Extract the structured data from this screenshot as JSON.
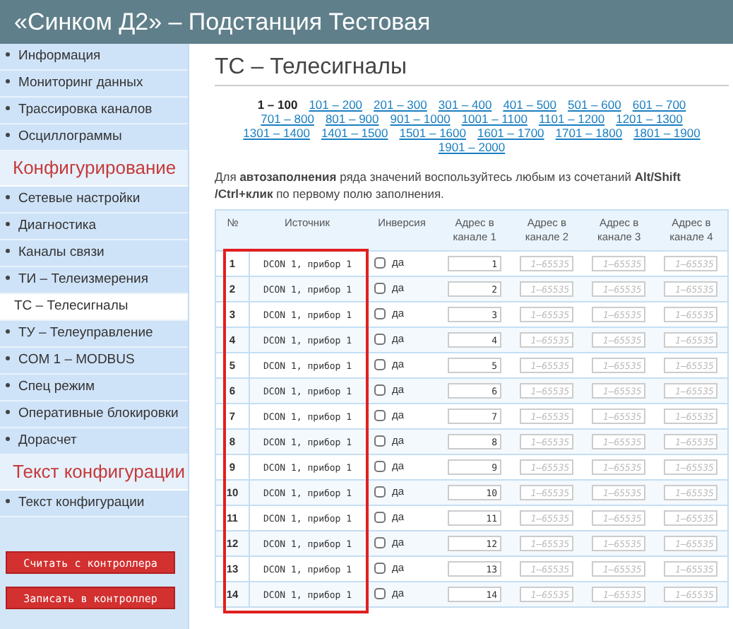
{
  "header": {
    "title": "«Синком Д2» – Подстанция Тестовая"
  },
  "sidebar": {
    "items": [
      {
        "kind": "item",
        "label": "Информация",
        "selected": false
      },
      {
        "kind": "item",
        "label": "Мониторинг данных",
        "selected": false
      },
      {
        "kind": "item",
        "label": "Трассировка каналов",
        "selected": false
      },
      {
        "kind": "item",
        "label": "Осциллограммы",
        "selected": false
      },
      {
        "kind": "section",
        "label": "Конфигурирование"
      },
      {
        "kind": "item",
        "label": "Сетевые настройки",
        "selected": false
      },
      {
        "kind": "item",
        "label": "Диагностика",
        "selected": false
      },
      {
        "kind": "item",
        "label": "Каналы связи",
        "selected": false
      },
      {
        "kind": "item",
        "label": "ТИ – Телеизмерения",
        "selected": false
      },
      {
        "kind": "item",
        "label": "ТС – Телесигналы",
        "selected": true
      },
      {
        "kind": "item",
        "label": "ТУ – Телеуправление",
        "selected": false
      },
      {
        "kind": "item",
        "label": "COM 1 – MODBUS",
        "selected": false
      },
      {
        "kind": "item",
        "label": "Спец режим",
        "selected": false
      },
      {
        "kind": "item",
        "label": "Оперативные блокировки",
        "selected": false
      },
      {
        "kind": "item",
        "label": "Дорасчет",
        "selected": false
      },
      {
        "kind": "section",
        "label": "Текст конфигурации"
      },
      {
        "kind": "item",
        "label": "Текст конфигурации",
        "selected": false
      }
    ],
    "buttons": [
      "Считать с контроллера",
      "Записать в контроллер"
    ]
  },
  "page": {
    "title": "ТС – Телесигналы",
    "ranges": [
      {
        "label": "1 – 100",
        "selected": true
      },
      {
        "label": "101 – 200",
        "selected": false
      },
      {
        "label": "201 – 300",
        "selected": false
      },
      {
        "label": "301 – 400",
        "selected": false
      },
      {
        "label": "401 – 500",
        "selected": false
      },
      {
        "label": "501 – 600",
        "selected": false
      },
      {
        "label": "601 – 700",
        "selected": false
      },
      {
        "label": "701 – 800",
        "selected": false
      },
      {
        "label": "801 – 900",
        "selected": false
      },
      {
        "label": "901 – 1000",
        "selected": false
      },
      {
        "label": "1001 – 1100",
        "selected": false
      },
      {
        "label": "1101 – 1200",
        "selected": false
      },
      {
        "label": "1201 – 1300",
        "selected": false
      },
      {
        "label": "1301 – 1400",
        "selected": false
      },
      {
        "label": "1401 – 1500",
        "selected": false
      },
      {
        "label": "1501 – 1600",
        "selected": false
      },
      {
        "label": "1601 – 1700",
        "selected": false
      },
      {
        "label": "1701 – 1800",
        "selected": false
      },
      {
        "label": "1801 – 1900",
        "selected": false
      },
      {
        "label": "1901 – 2000",
        "selected": false
      }
    ],
    "hint": "Для **автозаполнения** ряда значений воспользуйтесь любым из сочетаний **Alt/Shift /Ctrl+клик** по первому полю заполнения.",
    "table": {
      "columns": [
        "№",
        "Источник",
        "Инверсия",
        "Адрес в канале 1",
        "Адрес в канале 2",
        "Адрес в канале 3",
        "Адрес в канале 4"
      ],
      "rows": [
        {
          "number": "1",
          "source": "DCON 1, прибор 1",
          "inversion": {
            "label": "да",
            "checked": false
          },
          "addresses": [
            {
              "value": "1"
            },
            {
              "placeholder": "1–65535"
            },
            {
              "placeholder": "1–65535"
            },
            {
              "placeholder": "1–65535"
            }
          ]
        },
        {
          "number": "2",
          "source": "DCON 1, прибор 1",
          "inversion": {
            "label": "да",
            "checked": false
          },
          "addresses": [
            {
              "value": "2"
            },
            {
              "placeholder": "1–65535"
            },
            {
              "placeholder": "1–65535"
            },
            {
              "placeholder": "1–65535"
            }
          ]
        },
        {
          "number": "3",
          "source": "DCON 1, прибор 1",
          "inversion": {
            "label": "да",
            "checked": false
          },
          "addresses": [
            {
              "value": "3"
            },
            {
              "placeholder": "1–65535"
            },
            {
              "placeholder": "1–65535"
            },
            {
              "placeholder": "1–65535"
            }
          ]
        },
        {
          "number": "4",
          "source": "DCON 1, прибор 1",
          "inversion": {
            "label": "да",
            "checked": false
          },
          "addresses": [
            {
              "value": "4"
            },
            {
              "placeholder": "1–65535"
            },
            {
              "placeholder": "1–65535"
            },
            {
              "placeholder": "1–65535"
            }
          ]
        },
        {
          "number": "5",
          "source": "DCON 1, прибор 1",
          "inversion": {
            "label": "да",
            "checked": false
          },
          "addresses": [
            {
              "value": "5"
            },
            {
              "placeholder": "1–65535"
            },
            {
              "placeholder": "1–65535"
            },
            {
              "placeholder": "1–65535"
            }
          ]
        },
        {
          "number": "6",
          "source": "DCON 1, прибор 1",
          "inversion": {
            "label": "да",
            "checked": false
          },
          "addresses": [
            {
              "value": "6"
            },
            {
              "placeholder": "1–65535"
            },
            {
              "placeholder": "1–65535"
            },
            {
              "placeholder": "1–65535"
            }
          ]
        },
        {
          "number": "7",
          "source": "DCON 1, прибор 1",
          "inversion": {
            "label": "да",
            "checked": false
          },
          "addresses": [
            {
              "value": "7"
            },
            {
              "placeholder": "1–65535"
            },
            {
              "placeholder": "1–65535"
            },
            {
              "placeholder": "1–65535"
            }
          ]
        },
        {
          "number": "8",
          "source": "DCON 1, прибор 1",
          "inversion": {
            "label": "да",
            "checked": false
          },
          "addresses": [
            {
              "value": "8"
            },
            {
              "placeholder": "1–65535"
            },
            {
              "placeholder": "1–65535"
            },
            {
              "placeholder": "1–65535"
            }
          ]
        },
        {
          "number": "9",
          "source": "DCON 1, прибор 1",
          "inversion": {
            "label": "да",
            "checked": false
          },
          "addresses": [
            {
              "value": "9"
            },
            {
              "placeholder": "1–65535"
            },
            {
              "placeholder": "1–65535"
            },
            {
              "placeholder": "1–65535"
            }
          ]
        },
        {
          "number": "10",
          "source": "DCON 1, прибор 1",
          "inversion": {
            "label": "да",
            "checked": false
          },
          "addresses": [
            {
              "value": "10"
            },
            {
              "placeholder": "1–65535"
            },
            {
              "placeholder": "1–65535"
            },
            {
              "placeholder": "1–65535"
            }
          ]
        },
        {
          "number": "11",
          "source": "DCON 1, прибор 1",
          "inversion": {
            "label": "да",
            "checked": false
          },
          "addresses": [
            {
              "value": "11"
            },
            {
              "placeholder": "1–65535"
            },
            {
              "placeholder": "1–65535"
            },
            {
              "placeholder": "1–65535"
            }
          ]
        },
        {
          "number": "12",
          "source": "DCON 1, прибор 1",
          "inversion": {
            "label": "да",
            "checked": false
          },
          "addresses": [
            {
              "value": "12"
            },
            {
              "placeholder": "1–65535"
            },
            {
              "placeholder": "1–65535"
            },
            {
              "placeholder": "1–65535"
            }
          ]
        },
        {
          "number": "13",
          "source": "DCON 1, прибор 1",
          "inversion": {
            "label": "да",
            "checked": false
          },
          "addresses": [
            {
              "value": "13"
            },
            {
              "placeholder": "1–65535"
            },
            {
              "placeholder": "1–65535"
            },
            {
              "placeholder": "1–65535"
            }
          ]
        },
        {
          "number": "14",
          "source": "DCON 1, прибор 1",
          "inversion": {
            "label": "да",
            "checked": false
          },
          "addresses": [
            {
              "value": "14"
            },
            {
              "placeholder": "1–65535"
            },
            {
              "placeholder": "1–65535"
            },
            {
              "placeholder": "1–65535"
            }
          ]
        }
      ]
    }
  }
}
